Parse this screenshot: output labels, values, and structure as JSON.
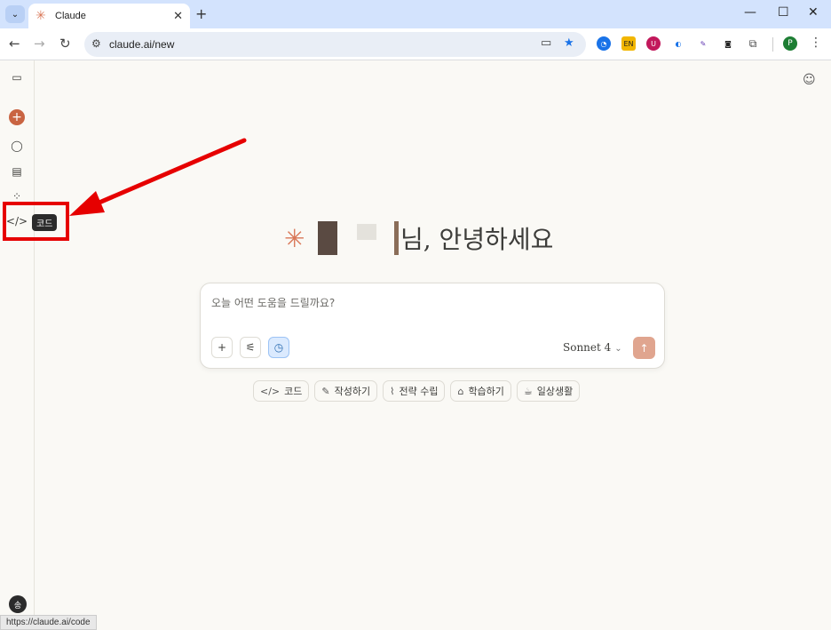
{
  "browser": {
    "tab_title": "Claude",
    "tab_favicon": "✳",
    "url": "claude.ai/new",
    "profile_initial": "P",
    "status_url": "https://claude.ai/code"
  },
  "sidebar": {
    "tooltip": "코드",
    "avatar_initial": "송"
  },
  "main": {
    "greeting_suffix": "님, 안녕하세요",
    "input_placeholder": "오늘 어떤 도움을 드릴까요?",
    "model_name": "Sonnet 4",
    "chips": [
      {
        "icon": "</>",
        "label": "코드"
      },
      {
        "icon": "✎",
        "label": "작성하기"
      },
      {
        "icon": "⌇",
        "label": "전략 수립"
      },
      {
        "icon": "⌂",
        "label": "학습하기"
      },
      {
        "icon": "☕",
        "label": "일상생활"
      }
    ]
  },
  "colors": {
    "accent": "#d97757",
    "highlight_box": "#e60000",
    "background": "#faf9f5"
  }
}
